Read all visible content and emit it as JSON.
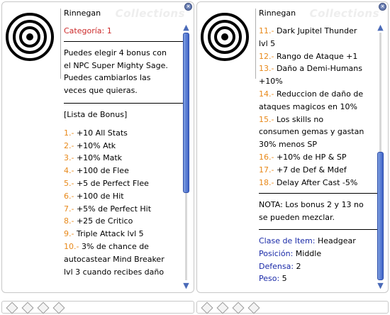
{
  "left_window": {
    "title": "Rinnegan",
    "watermark": "Collections",
    "close_glyph": "×",
    "category": "Categoría: 1",
    "description": [
      "Puedes elegir 4 bonus con",
      "el NPC Super Mighty Sage.",
      "Puedes cambiarlos las",
      "veces que quieras."
    ],
    "list_header": "[Lista de Bonus]",
    "bonuses": [
      {
        "num": "1.-",
        "text": " +10 All Stats"
      },
      {
        "num": "2.-",
        "text": " +10% Atk"
      },
      {
        "num": "3.-",
        "text": " +10% Matk"
      },
      {
        "num": "4.-",
        "text": " +100 de Flee"
      },
      {
        "num": "5.-",
        "text": " +5 de Perfect Flee"
      },
      {
        "num": "6.-",
        "text": " +100 de Hit"
      },
      {
        "num": "7.-",
        "text": " +5% de Perfect Hit"
      },
      {
        "num": "8.-",
        "text": " +25 de Critico"
      },
      {
        "num": "9.-",
        "text": " Triple Attack lvl 5"
      },
      {
        "num": "10.-",
        "text": " 3% de chance de"
      },
      {
        "num": "",
        "text": "autocastear Mind Breaker"
      },
      {
        "num": "",
        "text": "lvl 3 cuando recibes daño"
      }
    ]
  },
  "right_window": {
    "title": "Rinnegan",
    "watermark": "Collections",
    "close_glyph": "×",
    "bonuses": [
      {
        "num": "11.-",
        "text": " Dark Jupitel Thunder"
      },
      {
        "num": "",
        "text": "lvl 5"
      },
      {
        "num": "12.-",
        "text": " Rango de Ataque +1"
      },
      {
        "num": "13.-",
        "text": " Daño a Demi-Humans"
      },
      {
        "num": "",
        "text": "+10%"
      },
      {
        "num": "14.-",
        "text": " Reduccion de daño de"
      },
      {
        "num": "",
        "text": "ataques magicos en 10%"
      },
      {
        "num": "15.-",
        "text": " Los skills no"
      },
      {
        "num": "",
        "text": "consumen gemas y gastan"
      },
      {
        "num": "",
        "text": "30% menos SP"
      },
      {
        "num": "16.-",
        "text": " +10% de HP & SP"
      },
      {
        "num": "17.-",
        "text": " +7 de Def & Mdef"
      },
      {
        "num": "18.-",
        "text": " Delay After Cast -5%"
      }
    ],
    "note": [
      "NOTA: Los bonus 2 y 13 no",
      "se pueden mezclar."
    ],
    "info": [
      {
        "label": "Clase de Item:",
        "value": " Headgear"
      },
      {
        "label": "Posición:",
        "value": " Middle"
      },
      {
        "label": "Defensa:",
        "value": " 2"
      },
      {
        "label": "Peso:",
        "value": " 5"
      }
    ]
  },
  "scroll_glyphs": {
    "up": "▲",
    "down": "▼"
  },
  "icon": "target-rings-icon",
  "colors": {
    "category_red": "#cc2a2a",
    "number_orange": "#e8891a",
    "label_blue": "#1a2aa8",
    "scroll_blue": "#3f63c8"
  }
}
